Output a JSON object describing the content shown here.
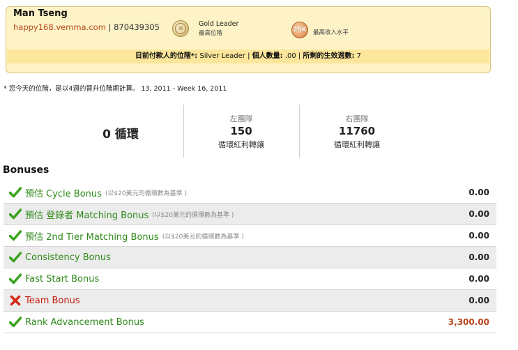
{
  "profile": {
    "name": "Man Tseng",
    "site": "happy168.vemma.com",
    "separator": " | ",
    "member_id": "870439305",
    "highest_rank_title": "Gold Leader",
    "highest_rank_label": "最高位階",
    "highest_income_label": "最高收入水平",
    "income_badge": "25K",
    "status_bar": {
      "paid_rank_label": "目前付款人的位階*:",
      "paid_rank_value": "Silver Leader",
      "sep1": " | ",
      "personal_qty_label": "個人數量:",
      "personal_qty_value": ".00",
      "sep2": " | ",
      "active_weeks_label": "所剩的生效週數:",
      "active_weeks_value": "7"
    }
  },
  "note": "* 您今天的位階，是以4週的晉升位階期計算。 13, 2011 - Week 16, 2011",
  "stats": {
    "cycles": "0 循環",
    "left_team": {
      "label": "左團隊",
      "value": "150",
      "caption": "循環紅利轉讓"
    },
    "right_team": {
      "label": "右團隊",
      "value": "11760",
      "caption": "循環紅利轉讓"
    }
  },
  "bonuses": {
    "title": "Bonuses",
    "items": [
      {
        "name": "預估 Cycle Bonus",
        "note": "(以$20美元的循環數為基準 )",
        "value": "0.00",
        "status": "check"
      },
      {
        "name": "預估 登錄者 Matching Bonus",
        "note": "(以$20美元的循環數為基準 )",
        "value": "0.00",
        "status": "check"
      },
      {
        "name": "預估 2nd Tier Matching Bonus",
        "note": "(以$20美元的循環數為基準 )",
        "value": "0.00",
        "status": "check"
      },
      {
        "name": "Consistency Bonus",
        "note": "",
        "value": "0.00",
        "status": "check"
      },
      {
        "name": "Fast Start Bonus",
        "note": "",
        "value": "0.00",
        "status": "check"
      },
      {
        "name": "Team Bonus",
        "note": "",
        "value": "0.00",
        "status": "cross"
      },
      {
        "name": "Rank Advancement Bonus",
        "note": "",
        "value": "3,300.00",
        "status": "check"
      }
    ]
  },
  "colors": {
    "check": "#3aa31e",
    "cross": "#d42a16",
    "link": "#b8461b",
    "panel_bg": "#fdf3c7",
    "status_bg": "#fce69b"
  }
}
